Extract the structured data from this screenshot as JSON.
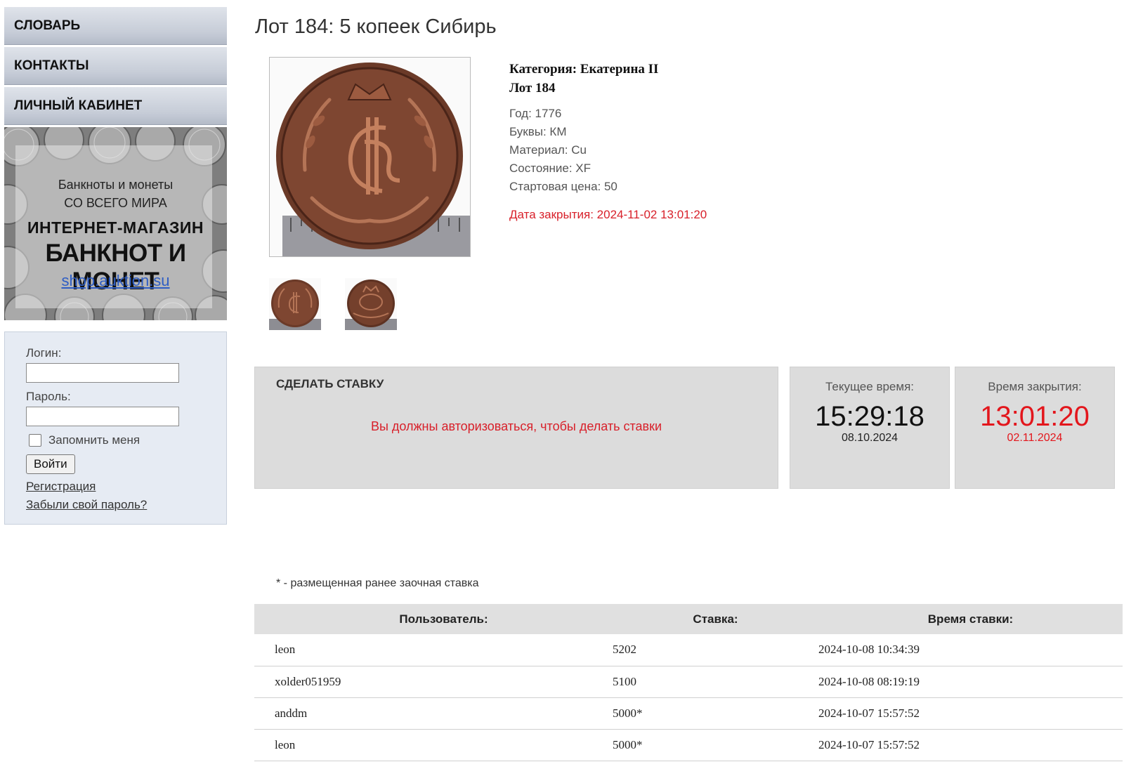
{
  "sidebar": {
    "nav": [
      "СЛОВАРЬ",
      "КОНТАКТЫ",
      "ЛИЧНЫЙ КАБИНЕТ"
    ],
    "banner": {
      "line1": "Банкноты и монеты",
      "line2": "СО ВСЕГО МИРА",
      "title1": "ИНТЕРНЕТ-МАГАЗИН",
      "title2": "БАНКНОТ И МОНЕТ",
      "link": "shop.auktion.su"
    },
    "login": {
      "login_label": "Логин:",
      "login_value": "",
      "password_label": "Пароль:",
      "password_value": "",
      "remember_label": "Запомнить меня",
      "submit_label": "Войти",
      "register_link": "Регистрация",
      "forgot_link": "Забыли свой пароль?"
    }
  },
  "lot": {
    "title": "Лот 184: 5 копеек Сибирь",
    "category": "Категория: Екатерина II",
    "lot_number": "Лот 184",
    "year": "Год: 1776",
    "letters": "Буквы: КМ",
    "material": "Материал: Cu",
    "condition": "Состояние: XF",
    "start_price": "Стартовая цена: 50",
    "close_date": "Дата закрытия: 2024-11-02 13:01:20"
  },
  "bid": {
    "title": "СДЕЛАТЬ СТАВКУ",
    "message": "Вы должны авторизоваться, чтобы делать ставки"
  },
  "clock": {
    "now_label": "Текущее время:",
    "now_time": "15:29:18",
    "now_date": "08.10.2024",
    "close_label": "Время закрытия:",
    "close_time": "13:01:20",
    "close_date": "02.11.2024"
  },
  "bids": {
    "note": "* - размещенная ранее заочная ставка",
    "headers": [
      "Пользователь:",
      "Ставка:",
      "Время ставки:"
    ],
    "rows": [
      {
        "user": "leon",
        "bid": "5202",
        "time": "2024-10-08 10:34:39"
      },
      {
        "user": "xolder051959",
        "bid": "5100",
        "time": "2024-10-08 08:19:19"
      },
      {
        "user": "anddm",
        "bid": "5000*",
        "time": "2024-10-07 15:57:52"
      },
      {
        "user": "leon",
        "bid": "5000*",
        "time": "2024-10-07 15:57:52"
      }
    ]
  },
  "colors": {
    "accent_red": "#d8202a",
    "panel_gray": "#dcdcdc",
    "login_bg": "#e6ebf3",
    "link_blue": "#2f5ec4"
  }
}
